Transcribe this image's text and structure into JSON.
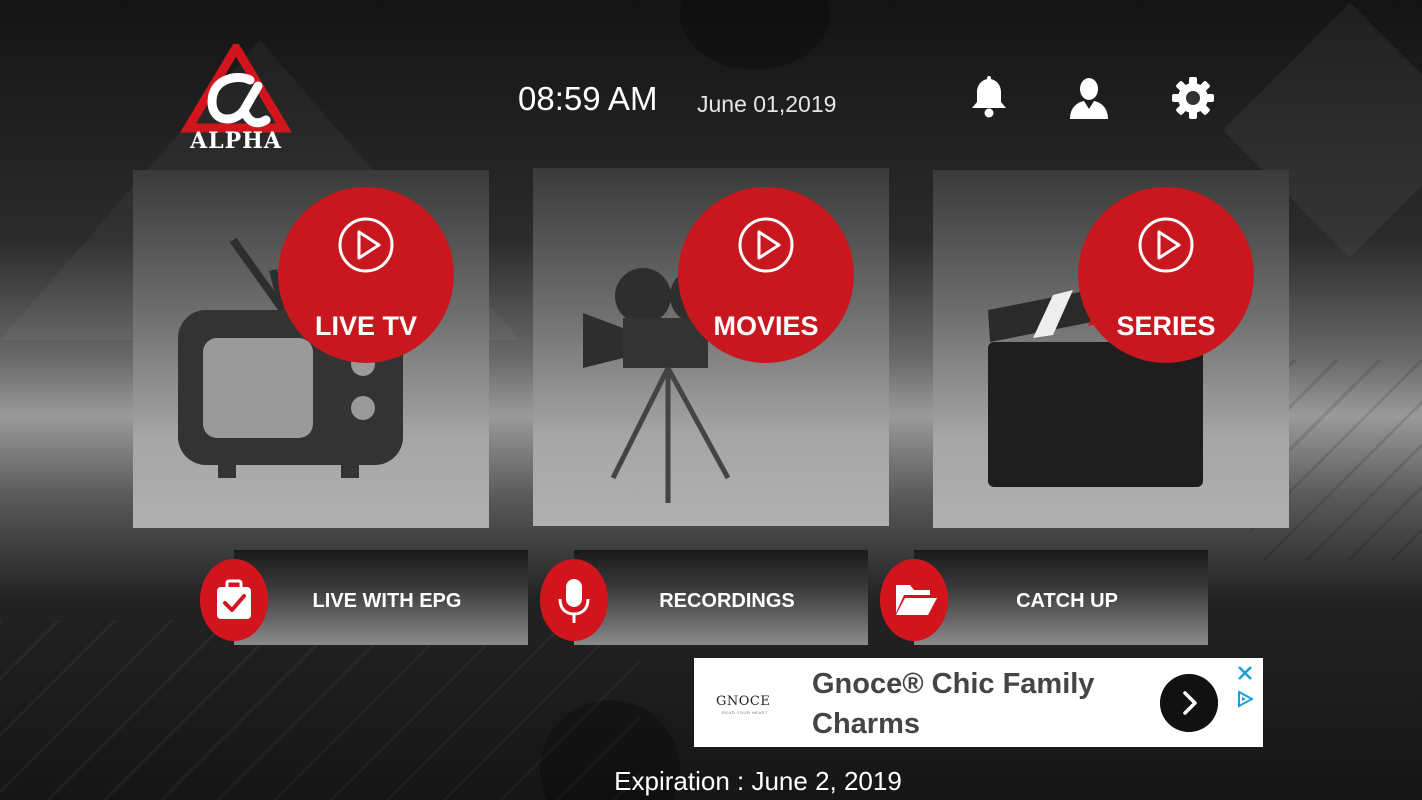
{
  "brand": {
    "logo_text": "ALPHA",
    "accent_color": "#c8171e"
  },
  "header": {
    "time": "08:59 AM",
    "date": "June 01,2019",
    "icons": [
      "bell-icon",
      "user-icon",
      "gear-icon"
    ]
  },
  "main_tiles": [
    {
      "label": "LIVE TV",
      "icon": "play-icon",
      "art": "television"
    },
    {
      "label": "MOVIES",
      "icon": "play-icon",
      "art": "film-projector"
    },
    {
      "label": "SERIES",
      "icon": "play-icon",
      "art": "clapperboard"
    }
  ],
  "secondary_tiles": [
    {
      "label": "LIVE WITH EPG",
      "icon": "calendar-check-icon"
    },
    {
      "label": "RECORDINGS",
      "icon": "microphone-icon"
    },
    {
      "label": "CATCH UP",
      "icon": "folder-open-icon"
    }
  ],
  "ad": {
    "brand": "GNOCE",
    "brand_tagline": "READ YOUR HEART",
    "title": "Gnoce® Chic Family Charms"
  },
  "footer": {
    "expiration": "Expiration : June 2, 2019"
  }
}
